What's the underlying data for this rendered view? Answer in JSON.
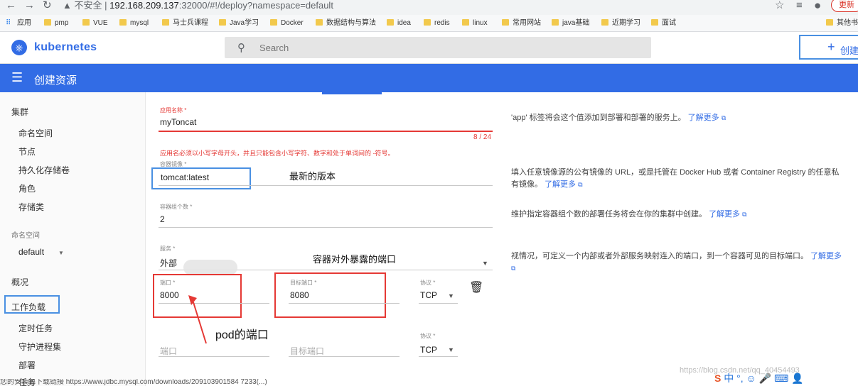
{
  "browser": {
    "insecure_label": "不安全",
    "url_host": "192.168.209.137",
    "url_rest": ":32000/#!/deploy?namespace=default",
    "update_label": "更新",
    "bookmarks": [
      "应用",
      "pmp",
      "VUE",
      "mysql",
      "马士兵课程",
      "Java学习",
      "Docker",
      "数据结构与算法",
      "idea",
      "redis",
      "linux",
      "常用网站",
      "java基础",
      "近期学习",
      "面试",
      "其他书"
    ]
  },
  "header": {
    "brand": "kubernetes",
    "search_placeholder": "Search",
    "create_label": "创建"
  },
  "titlebar": {
    "title": "创建资源"
  },
  "sidebar": {
    "cluster_heading": "集群",
    "cluster_items": [
      "命名空间",
      "节点",
      "持久化存储卷",
      "角色",
      "存储类"
    ],
    "namespace_heading": "命名空间",
    "namespace_value": "default",
    "overview": "概况",
    "workloads": "工作负载",
    "workload_items": [
      "定时任务",
      "守护进程集",
      "部署",
      "任务"
    ]
  },
  "form": {
    "app_name_label": "应用名称 *",
    "app_name_value": "myToncat",
    "app_name_counter": "8 / 24",
    "app_name_error": "应用名必须以小写字母开头，并且只能包含小写字符、数字和处于单词间的 -符号。",
    "image_label": "容器镜像 *",
    "image_value": "tomcat:latest",
    "pods_label": "容器组个数 *",
    "pods_value": "2",
    "service_label": "服务 *",
    "service_value": "外部",
    "port_label": "端口 *",
    "port_value": "8000",
    "target_port_label": "目标端口 *",
    "target_port_value": "8080",
    "protocol_label": "协议 *",
    "protocol_value": "TCP",
    "port_placeholder": "端口",
    "target_port_placeholder": "目标端口",
    "protocol2_label": "协议 *",
    "protocol2_value": "TCP"
  },
  "hints": {
    "app_name": "'app' 标签将会这个值添加到部署和部署的服务上。",
    "image": "填入任意镜像源的公有镜像的 URL，或是托管在 Docker Hub 或者 Container Registry 的任意私有镜像。",
    "pods": "维护指定容器组个数的部署任务将会在你的集群中创建。",
    "service": "视情况，可定义一个内部或者外部服务映射连入的端口，到一个容器可见的目标端口。",
    "learn_more": "了解更多"
  },
  "annotations": {
    "latest": "最新的版本",
    "exposed_port": "容器对外暴露的端口",
    "pod_port": "pod的端口"
  },
  "footer": {
    "watermark": "https://blog.csdn.net/qq_40454493",
    "bottom_text": "您的安装包下载链接 https://www.jdbc.mysql.com/downloads/209103901584 7233(...)"
  },
  "colors": {
    "brand": "#326ce5",
    "error": "#e53935",
    "annotation_box": "#4a90e2"
  }
}
